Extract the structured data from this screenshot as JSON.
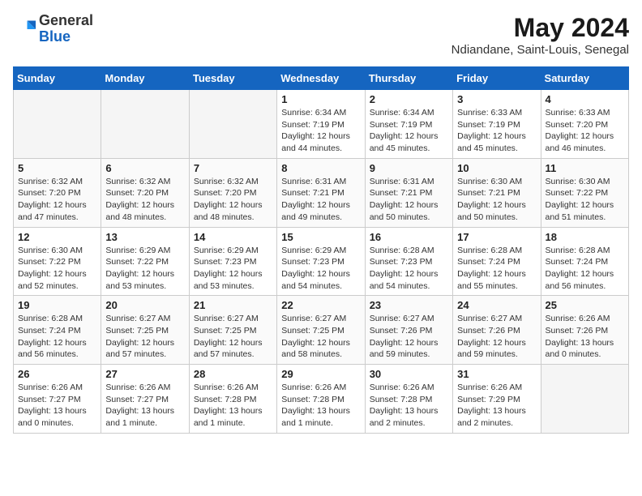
{
  "header": {
    "logo_general": "General",
    "logo_blue": "Blue",
    "month": "May 2024",
    "location": "Ndiandane, Saint-Louis, Senegal"
  },
  "days_of_week": [
    "Sunday",
    "Monday",
    "Tuesday",
    "Wednesday",
    "Thursday",
    "Friday",
    "Saturday"
  ],
  "weeks": [
    [
      {
        "day": "",
        "info": ""
      },
      {
        "day": "",
        "info": ""
      },
      {
        "day": "",
        "info": ""
      },
      {
        "day": "1",
        "info": "Sunrise: 6:34 AM\nSunset: 7:19 PM\nDaylight: 12 hours\nand 44 minutes."
      },
      {
        "day": "2",
        "info": "Sunrise: 6:34 AM\nSunset: 7:19 PM\nDaylight: 12 hours\nand 45 minutes."
      },
      {
        "day": "3",
        "info": "Sunrise: 6:33 AM\nSunset: 7:19 PM\nDaylight: 12 hours\nand 45 minutes."
      },
      {
        "day": "4",
        "info": "Sunrise: 6:33 AM\nSunset: 7:20 PM\nDaylight: 12 hours\nand 46 minutes."
      }
    ],
    [
      {
        "day": "5",
        "info": "Sunrise: 6:32 AM\nSunset: 7:20 PM\nDaylight: 12 hours\nand 47 minutes."
      },
      {
        "day": "6",
        "info": "Sunrise: 6:32 AM\nSunset: 7:20 PM\nDaylight: 12 hours\nand 48 minutes."
      },
      {
        "day": "7",
        "info": "Sunrise: 6:32 AM\nSunset: 7:20 PM\nDaylight: 12 hours\nand 48 minutes."
      },
      {
        "day": "8",
        "info": "Sunrise: 6:31 AM\nSunset: 7:21 PM\nDaylight: 12 hours\nand 49 minutes."
      },
      {
        "day": "9",
        "info": "Sunrise: 6:31 AM\nSunset: 7:21 PM\nDaylight: 12 hours\nand 50 minutes."
      },
      {
        "day": "10",
        "info": "Sunrise: 6:30 AM\nSunset: 7:21 PM\nDaylight: 12 hours\nand 50 minutes."
      },
      {
        "day": "11",
        "info": "Sunrise: 6:30 AM\nSunset: 7:22 PM\nDaylight: 12 hours\nand 51 minutes."
      }
    ],
    [
      {
        "day": "12",
        "info": "Sunrise: 6:30 AM\nSunset: 7:22 PM\nDaylight: 12 hours\nand 52 minutes."
      },
      {
        "day": "13",
        "info": "Sunrise: 6:29 AM\nSunset: 7:22 PM\nDaylight: 12 hours\nand 53 minutes."
      },
      {
        "day": "14",
        "info": "Sunrise: 6:29 AM\nSunset: 7:23 PM\nDaylight: 12 hours\nand 53 minutes."
      },
      {
        "day": "15",
        "info": "Sunrise: 6:29 AM\nSunset: 7:23 PM\nDaylight: 12 hours\nand 54 minutes."
      },
      {
        "day": "16",
        "info": "Sunrise: 6:28 AM\nSunset: 7:23 PM\nDaylight: 12 hours\nand 54 minutes."
      },
      {
        "day": "17",
        "info": "Sunrise: 6:28 AM\nSunset: 7:24 PM\nDaylight: 12 hours\nand 55 minutes."
      },
      {
        "day": "18",
        "info": "Sunrise: 6:28 AM\nSunset: 7:24 PM\nDaylight: 12 hours\nand 56 minutes."
      }
    ],
    [
      {
        "day": "19",
        "info": "Sunrise: 6:28 AM\nSunset: 7:24 PM\nDaylight: 12 hours\nand 56 minutes."
      },
      {
        "day": "20",
        "info": "Sunrise: 6:27 AM\nSunset: 7:25 PM\nDaylight: 12 hours\nand 57 minutes."
      },
      {
        "day": "21",
        "info": "Sunrise: 6:27 AM\nSunset: 7:25 PM\nDaylight: 12 hours\nand 57 minutes."
      },
      {
        "day": "22",
        "info": "Sunrise: 6:27 AM\nSunset: 7:25 PM\nDaylight: 12 hours\nand 58 minutes."
      },
      {
        "day": "23",
        "info": "Sunrise: 6:27 AM\nSunset: 7:26 PM\nDaylight: 12 hours\nand 59 minutes."
      },
      {
        "day": "24",
        "info": "Sunrise: 6:27 AM\nSunset: 7:26 PM\nDaylight: 12 hours\nand 59 minutes."
      },
      {
        "day": "25",
        "info": "Sunrise: 6:26 AM\nSunset: 7:26 PM\nDaylight: 13 hours\nand 0 minutes."
      }
    ],
    [
      {
        "day": "26",
        "info": "Sunrise: 6:26 AM\nSunset: 7:27 PM\nDaylight: 13 hours\nand 0 minutes."
      },
      {
        "day": "27",
        "info": "Sunrise: 6:26 AM\nSunset: 7:27 PM\nDaylight: 13 hours\nand 1 minute."
      },
      {
        "day": "28",
        "info": "Sunrise: 6:26 AM\nSunset: 7:28 PM\nDaylight: 13 hours\nand 1 minute."
      },
      {
        "day": "29",
        "info": "Sunrise: 6:26 AM\nSunset: 7:28 PM\nDaylight: 13 hours\nand 1 minute."
      },
      {
        "day": "30",
        "info": "Sunrise: 6:26 AM\nSunset: 7:28 PM\nDaylight: 13 hours\nand 2 minutes."
      },
      {
        "day": "31",
        "info": "Sunrise: 6:26 AM\nSunset: 7:29 PM\nDaylight: 13 hours\nand 2 minutes."
      },
      {
        "day": "",
        "info": ""
      }
    ]
  ]
}
